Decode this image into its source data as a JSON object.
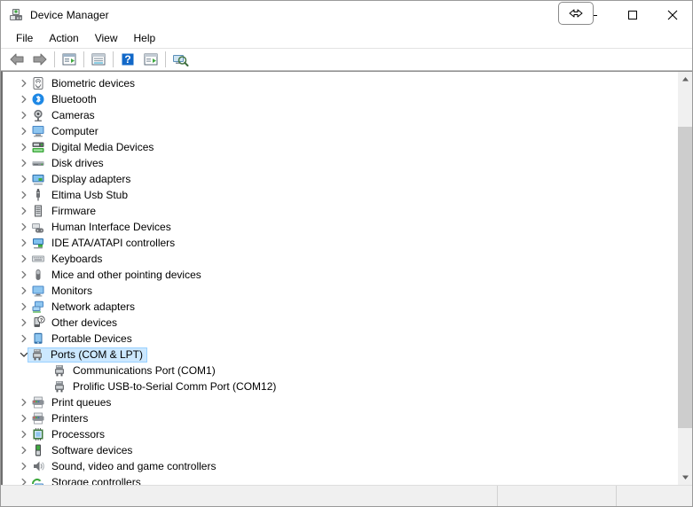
{
  "window": {
    "title": "Device Manager",
    "title_icon": "device-manager-icon",
    "cursor_overlay": "horizontal-resize-cursor"
  },
  "caption_buttons": [
    {
      "name": "minimize-button",
      "glyph": "minimize"
    },
    {
      "name": "maximize-button",
      "glyph": "maximize"
    },
    {
      "name": "close-button",
      "glyph": "close"
    }
  ],
  "menubar": {
    "items": [
      {
        "label": "File"
      },
      {
        "label": "Action"
      },
      {
        "label": "View"
      },
      {
        "label": "Help"
      }
    ]
  },
  "toolbar": {
    "buttons": [
      {
        "name": "back-button",
        "icon": "back-arrow-icon"
      },
      {
        "name": "forward-button",
        "icon": "forward-arrow-icon"
      },
      {
        "name": "separator-1",
        "icon": "separator"
      },
      {
        "name": "show-hide-console-tree-button",
        "icon": "console-tree-icon"
      },
      {
        "name": "separator-2",
        "icon": "separator"
      },
      {
        "name": "properties-button",
        "icon": "properties-icon"
      },
      {
        "name": "separator-3",
        "icon": "separator"
      },
      {
        "name": "help-button",
        "icon": "help-question-icon"
      },
      {
        "name": "update-driver-button",
        "icon": "update-driver-icon"
      },
      {
        "name": "separator-4",
        "icon": "separator"
      },
      {
        "name": "scan-for-hardware-changes-button",
        "icon": "scan-hardware-icon"
      }
    ]
  },
  "tree": {
    "rows": [
      {
        "label": "Biometric devices",
        "icon": "fingerprint-icon",
        "level": 0,
        "state": "collapsed",
        "selected": false
      },
      {
        "label": "Bluetooth",
        "icon": "bluetooth-icon",
        "level": 0,
        "state": "collapsed",
        "selected": false
      },
      {
        "label": "Cameras",
        "icon": "camera-icon",
        "level": 0,
        "state": "collapsed",
        "selected": false
      },
      {
        "label": "Computer",
        "icon": "computer-icon",
        "level": 0,
        "state": "collapsed",
        "selected": false
      },
      {
        "label": "Digital Media Devices",
        "icon": "digital-media-icon",
        "level": 0,
        "state": "collapsed",
        "selected": false
      },
      {
        "label": "Disk drives",
        "icon": "disk-drive-icon",
        "level": 0,
        "state": "collapsed",
        "selected": false
      },
      {
        "label": "Display adapters",
        "icon": "display-adapter-icon",
        "level": 0,
        "state": "collapsed",
        "selected": false
      },
      {
        "label": "Eltima Usb Stub",
        "icon": "usb-icon",
        "level": 0,
        "state": "collapsed",
        "selected": false
      },
      {
        "label": "Firmware",
        "icon": "firmware-chip-icon",
        "level": 0,
        "state": "collapsed",
        "selected": false
      },
      {
        "label": "Human Interface Devices",
        "icon": "hid-icon",
        "level": 0,
        "state": "collapsed",
        "selected": false
      },
      {
        "label": "IDE ATA/ATAPI controllers",
        "icon": "ide-controller-icon",
        "level": 0,
        "state": "collapsed",
        "selected": false
      },
      {
        "label": "Keyboards",
        "icon": "keyboard-icon",
        "level": 0,
        "state": "collapsed",
        "selected": false
      },
      {
        "label": "Mice and other pointing devices",
        "icon": "mouse-icon",
        "level": 0,
        "state": "collapsed",
        "selected": false
      },
      {
        "label": "Monitors",
        "icon": "monitor-icon",
        "level": 0,
        "state": "collapsed",
        "selected": false
      },
      {
        "label": "Network adapters",
        "icon": "network-adapter-icon",
        "level": 0,
        "state": "collapsed",
        "selected": false
      },
      {
        "label": "Other devices",
        "icon": "other-device-warning-icon",
        "level": 0,
        "state": "collapsed",
        "selected": false
      },
      {
        "label": "Portable Devices",
        "icon": "portable-device-icon",
        "level": 0,
        "state": "collapsed",
        "selected": false
      },
      {
        "label": "Ports (COM & LPT)",
        "icon": "port-icon",
        "level": 0,
        "state": "expanded",
        "selected": true
      },
      {
        "label": "Communications Port (COM1)",
        "icon": "port-icon",
        "level": 1,
        "state": "leaf",
        "selected": false
      },
      {
        "label": "Prolific USB-to-Serial Comm Port (COM12)",
        "icon": "port-icon",
        "level": 1,
        "state": "leaf",
        "selected": false
      },
      {
        "label": "Print queues",
        "icon": "print-queue-icon",
        "level": 0,
        "state": "collapsed",
        "selected": false
      },
      {
        "label": "Printers",
        "icon": "printer-icon",
        "level": 0,
        "state": "collapsed",
        "selected": false
      },
      {
        "label": "Processors",
        "icon": "processor-icon",
        "level": 0,
        "state": "collapsed",
        "selected": false
      },
      {
        "label": "Software devices",
        "icon": "software-device-icon",
        "level": 0,
        "state": "collapsed",
        "selected": false
      },
      {
        "label": "Sound, video and game controllers",
        "icon": "sound-icon",
        "level": 0,
        "state": "collapsed",
        "selected": false
      },
      {
        "label": "Storage controllers",
        "icon": "storage-controller-icon",
        "level": 0,
        "state": "collapsed",
        "selected": false
      }
    ]
  },
  "scrollbar": {
    "up_arrow": "scroll-up-arrow-icon",
    "down_arrow": "scroll-down-arrow-icon"
  },
  "statusbar": {
    "panes": [
      "",
      "",
      ""
    ]
  },
  "colors": {
    "selection_fill": "#cce8ff",
    "selection_border": "#99d1ff",
    "window_bg": "#ffffff",
    "chrome_bg": "#f0f0f0",
    "scroll_thumb": "#cdcdcd"
  }
}
